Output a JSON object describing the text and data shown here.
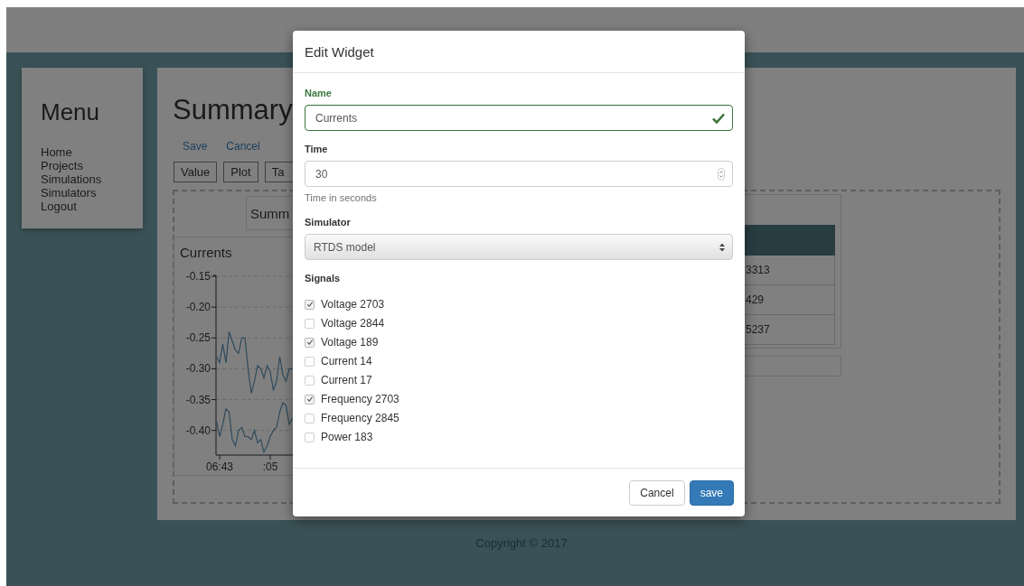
{
  "menu": {
    "title": "Menu",
    "items": [
      "Home",
      "Projects",
      "Simulations",
      "Simulators",
      "Logout"
    ]
  },
  "content": {
    "title": "Summary",
    "actions": [
      "Save",
      "Cancel"
    ],
    "toolbox": [
      "Value",
      "Plot",
      "Ta"
    ],
    "widgets": [
      {
        "kind": "label",
        "text": "Summ"
      },
      {
        "kind": "plot",
        "title": "Currents",
        "chart_data": {
          "type": "line",
          "categories": [
            null,
            "06:43",
            null,
            null,
            null,
            null,
            null,
            null,
            null,
            null,
            null,
            null,
            null,
            null,
            null,
            null,
            null,
            ":05",
            null,
            null,
            null,
            null,
            null,
            null,
            null
          ],
          "ylim": [
            -0.44,
            -0.15
          ],
          "grid": true,
          "yticks": [
            {
              "value": -0.15,
              "label": "-0.15"
            },
            {
              "value": -0.2,
              "label": "-0.20"
            },
            {
              "value": -0.25,
              "label": "-0.25"
            },
            {
              "value": -0.3,
              "label": "-0.30"
            },
            {
              "value": -0.35,
              "label": "-0.35"
            },
            {
              "value": -0.4,
              "label": "-0.40"
            }
          ],
          "series": [
            {
              "color": "#2f4a5c",
              "values": [
                -0.28,
                -0.29,
                -0.26,
                -0.29,
                -0.24,
                -0.255,
                -0.27,
                -0.275,
                -0.25,
                -0.25,
                -0.3,
                -0.34,
                -0.32,
                -0.295,
                -0.3,
                -0.315,
                -0.295,
                -0.305,
                -0.335,
                -0.32,
                -0.28,
                -0.31,
                -0.32,
                -0.3,
                -0.3
              ]
            },
            {
              "color": "#2f4a5c",
              "values": [
                -0.385,
                -0.41,
                -0.39,
                -0.365,
                -0.37,
                -0.415,
                -0.425,
                -0.4,
                -0.395,
                -0.41,
                -0.41,
                -0.415,
                -0.4,
                -0.42,
                -0.415,
                -0.435,
                -0.425,
                -0.41,
                -0.4,
                -0.395,
                -0.37,
                -0.355,
                -0.36,
                -0.39,
                -0.38
              ]
            }
          ]
        }
      },
      {
        "kind": "table",
        "cells": [
          "3313",
          "429",
          "5237"
        ]
      },
      {
        "kind": "box"
      }
    ]
  },
  "dialog": {
    "title": "Edit Widget",
    "fields": [
      {
        "kind": "text",
        "label": "Name",
        "value": "Currents",
        "valid": true
      },
      {
        "kind": "number",
        "label": "Time",
        "value": "30",
        "help": "Time in seconds"
      },
      {
        "kind": "select",
        "label": "Simulator",
        "value": "RTDS model"
      },
      {
        "kind": "checklist",
        "label": "Signals",
        "options": [
          {
            "label": "Voltage 2703",
            "checked": true
          },
          {
            "label": "Voltage 2844",
            "checked": false
          },
          {
            "label": "Voltage 189",
            "checked": true
          },
          {
            "label": "Current 14",
            "checked": false
          },
          {
            "label": "Current 17",
            "checked": false
          },
          {
            "label": "Frequency 2703",
            "checked": true
          },
          {
            "label": "Frequency 2845",
            "checked": false
          },
          {
            "label": "Power 183",
            "checked": false
          }
        ]
      }
    ],
    "buttons": [
      {
        "label": "Cancel",
        "kind": "default"
      },
      {
        "label": "save",
        "kind": "primary"
      }
    ]
  },
  "footer": {
    "copyright": "Copyright © 2017"
  }
}
